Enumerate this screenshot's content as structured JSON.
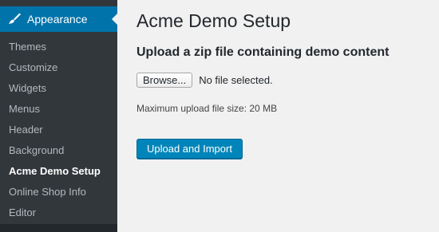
{
  "sidebar": {
    "active_menu": {
      "label": "Appearance",
      "icon": "paintbrush-icon"
    },
    "items": [
      {
        "label": "Themes"
      },
      {
        "label": "Customize"
      },
      {
        "label": "Widgets"
      },
      {
        "label": "Menus"
      },
      {
        "label": "Header"
      },
      {
        "label": "Background"
      },
      {
        "label": "Acme Demo Setup",
        "current": true
      },
      {
        "label": "Online Shop Info"
      },
      {
        "label": "Editor"
      }
    ]
  },
  "main": {
    "title": "Acme Demo Setup",
    "section_title": "Upload a zip file containing demo content",
    "browse_label": "Browse...",
    "file_status": "No file selected.",
    "max_size_text": "Maximum upload file size: 20 MB",
    "submit_label": "Upload and Import"
  },
  "colors": {
    "sidebar_bg": "#32373c",
    "active_menu_bg": "#0073aa",
    "primary_button": "#0085ba",
    "page_bg": "#f1f1f1"
  }
}
